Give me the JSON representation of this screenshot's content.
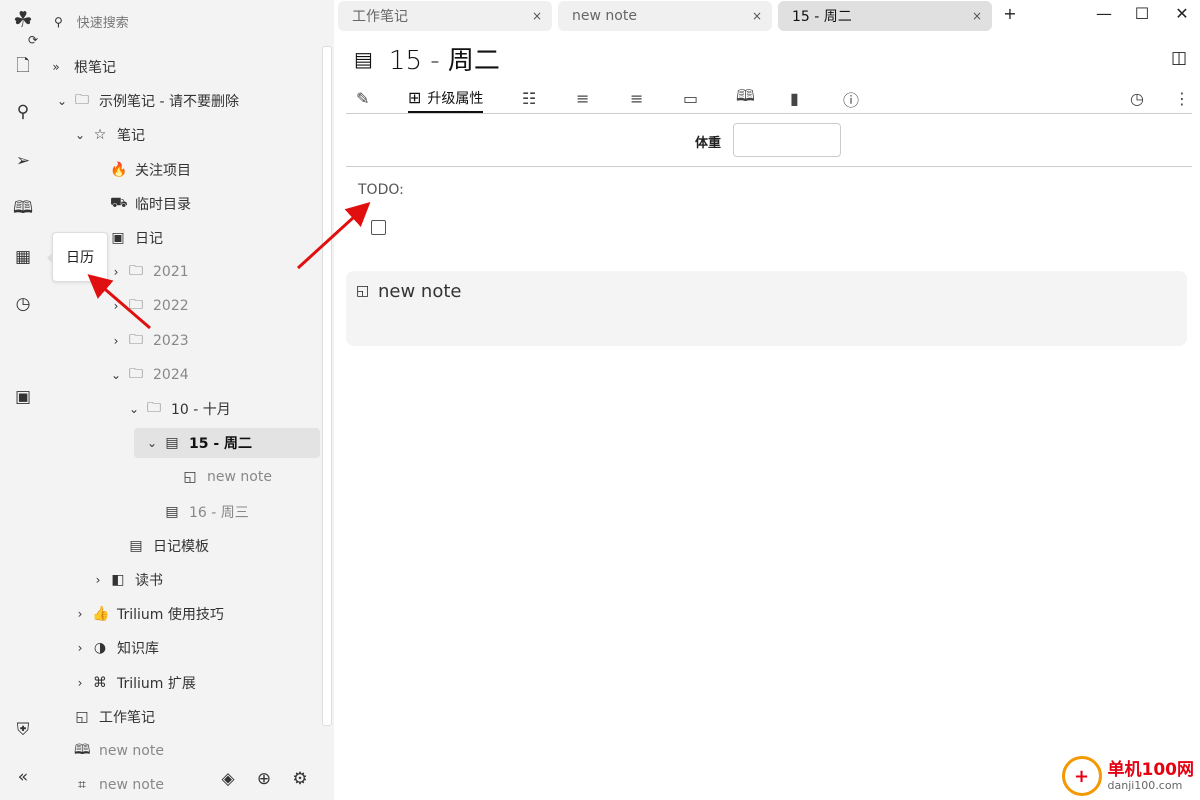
{
  "launcher": {
    "icons": [
      "trilium-logo-icon",
      "new-note-icon",
      "search-icon",
      "send-icon",
      "map-icon",
      "calendar-icon",
      "history-icon",
      "starred-calendar-icon",
      "shield-icon",
      "collapse-icon"
    ]
  },
  "tree": {
    "search_placeholder": "快速搜索",
    "items": [
      {
        "label": "根笔记",
        "depth": 0,
        "chev": "»",
        "icon": ""
      },
      {
        "label": "示例笔记 - 请不要删除",
        "depth": 1,
        "chev": "⌄",
        "icon": "🗀"
      },
      {
        "label": "笔记",
        "depth": 2,
        "chev": "⌄",
        "icon": "☆"
      },
      {
        "label": "关注项目",
        "depth": 3,
        "chev": "",
        "icon": "🔥"
      },
      {
        "label": "临时目录",
        "depth": 3,
        "chev": "",
        "icon": "⛟"
      },
      {
        "label": "日记",
        "depth": 3,
        "chev": "",
        "icon": "▣"
      },
      {
        "label": "2021",
        "depth": 4,
        "chev": "›",
        "icon": "🗀",
        "muted": true
      },
      {
        "label": "2022",
        "depth": 4,
        "chev": "›",
        "icon": "🗀",
        "muted": true
      },
      {
        "label": "2023",
        "depth": 4,
        "chev": "›",
        "icon": "🗀",
        "muted": true
      },
      {
        "label": "2024",
        "depth": 4,
        "chev": "⌄",
        "icon": "🗀",
        "muted": true
      },
      {
        "label": "10 - 十月",
        "depth": 5,
        "chev": "⌄",
        "icon": "🗀"
      },
      {
        "label": "15 - 周二",
        "depth": 6,
        "chev": "⌄",
        "icon": "▤",
        "selected": true
      },
      {
        "label": "new note",
        "depth": 7,
        "chev": "",
        "icon": "◱",
        "muted": true
      },
      {
        "label": "16 - 周三",
        "depth": 6,
        "chev": "",
        "icon": "▤",
        "muted": true
      },
      {
        "label": "日记模板",
        "depth": 4,
        "chev": "",
        "icon": "▤"
      },
      {
        "label": "读书",
        "depth": 3,
        "chev": "›",
        "icon": "◧"
      },
      {
        "label": "Trilium 使用技巧",
        "depth": 2,
        "chev": "›",
        "icon": "👍"
      },
      {
        "label": "知识库",
        "depth": 2,
        "chev": "›",
        "icon": "◑"
      },
      {
        "label": "Trilium 扩展",
        "depth": 2,
        "chev": "›",
        "icon": "⌘"
      },
      {
        "label": "工作笔记",
        "depth": 1,
        "chev": "",
        "icon": "◱"
      },
      {
        "label": "new note",
        "depth": 1,
        "chev": "",
        "icon": "🕮",
        "muted": true
      },
      {
        "label": "new note",
        "depth": 1,
        "chev": "",
        "icon": "⌗",
        "muted": true
      }
    ]
  },
  "tooltip": "日历",
  "tabs": [
    {
      "label": "工作笔记"
    },
    {
      "label": "new note"
    },
    {
      "label": "15 - 周二",
      "active": true
    }
  ],
  "note": {
    "title": "15 - 周二",
    "ribbon_active_label": "升级属性",
    "attribute_label": "体重",
    "attribute_value": "",
    "content": "TODO:",
    "checkbox_checked": false,
    "child_note": "new note"
  },
  "watermark": {
    "name": "单机100网",
    "url": "danji100.com"
  }
}
